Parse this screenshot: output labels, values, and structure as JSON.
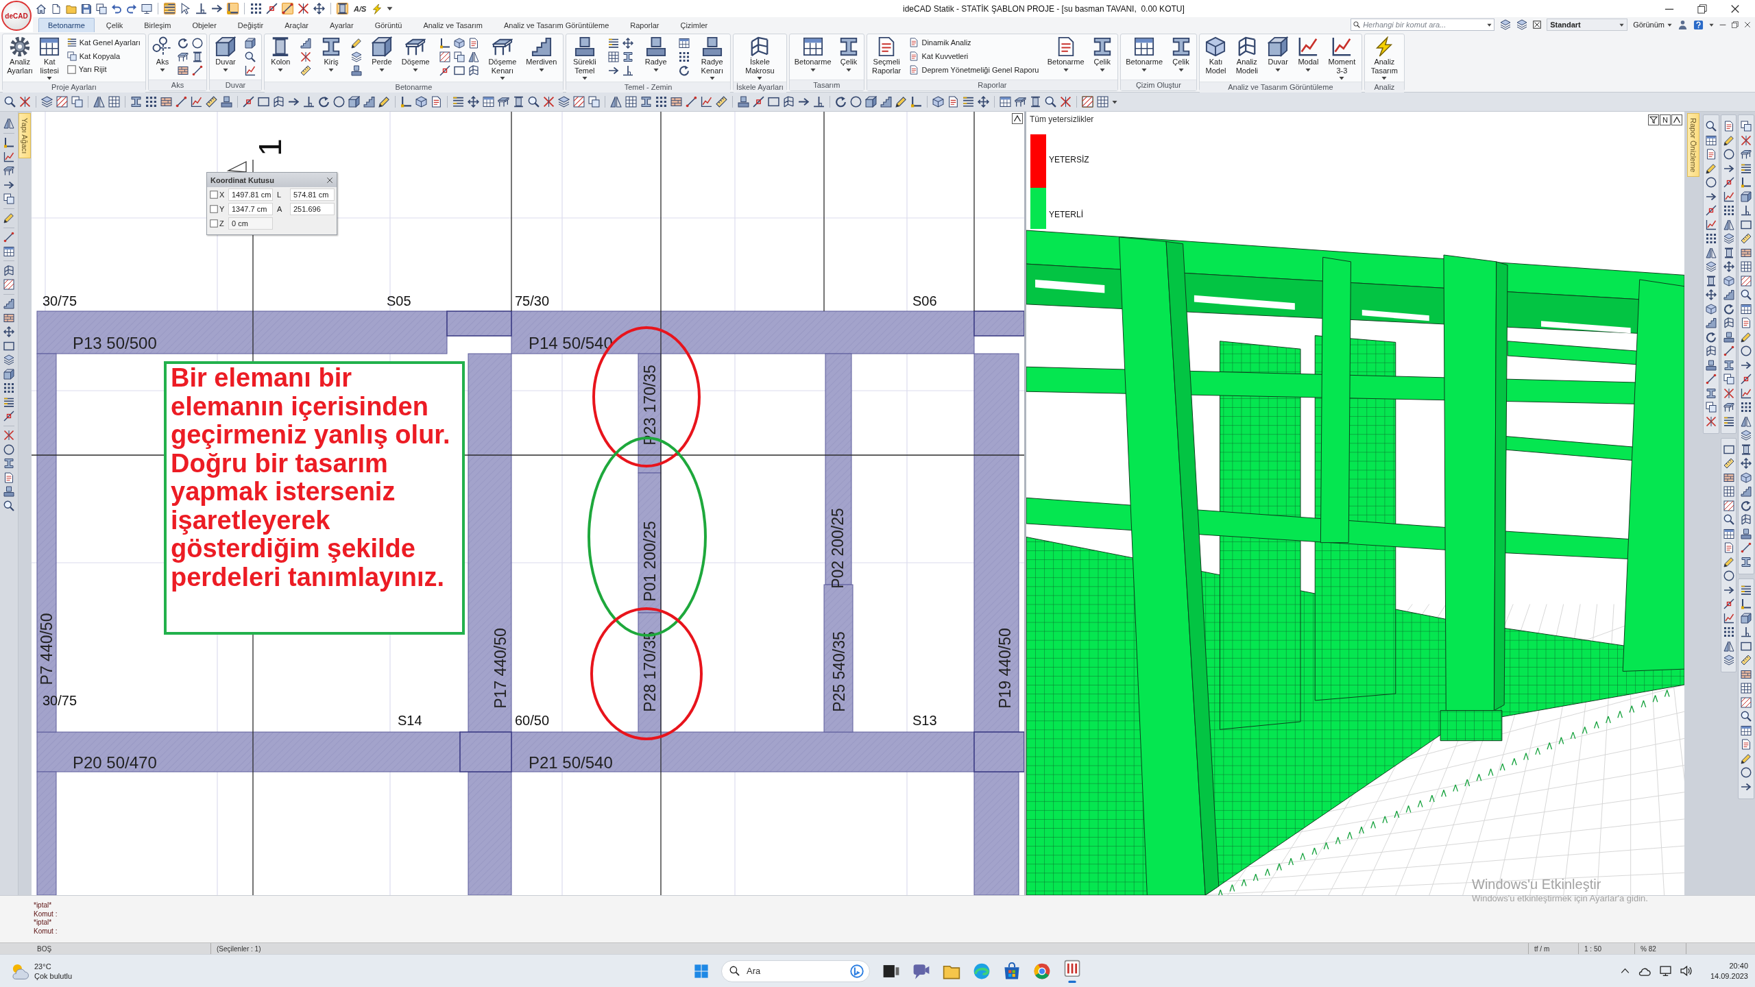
{
  "title_bar": {
    "logo": "deCAD",
    "snap_toggles": [
      {
        "on": true
      },
      {
        "on": false
      },
      {
        "on": false
      },
      {
        "on": false
      },
      {
        "on": true
      },
      {
        "on": false
      },
      {
        "on": false
      },
      {
        "on": true
      },
      {
        "on": false
      },
      {
        "on": false
      },
      {
        "on": true
      }
    ],
    "label_button": "A/S",
    "title": "ideCAD Statik - STATİK ŞABLON PROJE - [su basman TAVANI,  0.00 KOTU]"
  },
  "ribbon": {
    "tabs": [
      {
        "label": "Betonarme",
        "selected": true
      },
      {
        "label": "Çelik",
        "selected": false
      },
      {
        "label": "Birleşim",
        "selected": false
      },
      {
        "label": "Objeler",
        "selected": false
      },
      {
        "label": "Değiştir",
        "selected": false
      },
      {
        "label": "Araçlar",
        "selected": false
      },
      {
        "label": "Ayarlar",
        "selected": false
      },
      {
        "label": "Görüntü",
        "selected": false
      },
      {
        "label": "Analiz ve Tasarım",
        "selected": false
      },
      {
        "label": "Analiz ve Tasarım Görüntüleme",
        "selected": false
      },
      {
        "label": "Raporlar",
        "selected": false
      },
      {
        "label": "Çizimler",
        "selected": false
      }
    ],
    "search": {
      "placeholder": "Herhangi bir komut ara..."
    },
    "style_select": {
      "value": "Standart"
    },
    "view_menu": "Görünüm",
    "groups": [
      {
        "title": "Proje Ayarları",
        "items": [
          {
            "kind": "large",
            "label": "Analiz Ayarları",
            "menu": false
          },
          {
            "kind": "large",
            "label": "Kat listesi",
            "menu": true
          },
          {
            "kind": "stack",
            "rows": [
              {
                "kind": "small",
                "label": "Kat Genel Ayarları"
              },
              {
                "kind": "small",
                "label": "Kat Kopyala"
              },
              {
                "kind": "check",
                "label": "Yarı Rijit",
                "checked": false
              }
            ]
          }
        ]
      },
      {
        "title": "Aks",
        "items": [
          {
            "kind": "large",
            "label": "Aks",
            "menu": true
          },
          {
            "kind": "tools"
          }
        ]
      },
      {
        "title": "Duvar",
        "items": [
          {
            "kind": "large",
            "label": "Duvar",
            "menu": true
          },
          {
            "kind": "tools"
          }
        ]
      },
      {
        "title": "Betonarme",
        "items": [
          {
            "kind": "large",
            "label": "Kolon",
            "menu": true
          },
          {
            "kind": "tools"
          },
          {
            "kind": "large",
            "label": "Kiriş",
            "menu": true
          },
          {
            "kind": "tools"
          },
          {
            "kind": "large",
            "label": "Perde",
            "menu": true
          },
          {
            "kind": "large",
            "label": "Döşeme",
            "menu": true
          },
          {
            "kind": "tools"
          },
          {
            "kind": "large",
            "label": "Döşeme Kenarı",
            "menu": true
          },
          {
            "kind": "large",
            "label": "Merdiven",
            "menu": true
          }
        ]
      },
      {
        "title": "Temel - Zemin",
        "items": [
          {
            "kind": "large",
            "label": "Sürekli Temel",
            "menu": true
          },
          {
            "kind": "tools"
          },
          {
            "kind": "large",
            "label": "Radye",
            "menu": true
          },
          {
            "kind": "tools"
          },
          {
            "kind": "large",
            "label": "Radye Kenarı",
            "menu": true
          }
        ]
      },
      {
        "title": "İskele Ayarları",
        "items": [
          {
            "kind": "large",
            "label": "İskele Makrosu",
            "menu": true
          }
        ]
      },
      {
        "title": "Tasarım",
        "items": [
          {
            "kind": "large",
            "label": "Betonarme",
            "menu": true
          },
          {
            "kind": "large",
            "label": "Çelik",
            "menu": true
          }
        ]
      },
      {
        "title": "Raporlar",
        "items": [
          {
            "kind": "large",
            "label": "Seçmeli Raporlar",
            "menu": false
          },
          {
            "kind": "stack",
            "rows": [
              {
                "kind": "small",
                "label": "Dinamik Analiz"
              },
              {
                "kind": "small",
                "label": "Kat Kuvvetleri"
              },
              {
                "kind": "small",
                "label": "Deprem Yönetmeliği Genel Raporu"
              }
            ]
          },
          {
            "kind": "large",
            "label": "Betonarme",
            "menu": true
          },
          {
            "kind": "large",
            "label": "Çelik",
            "menu": true
          }
        ]
      },
      {
        "title": "Çizim Oluştur",
        "items": [
          {
            "kind": "large",
            "label": "Betonarme",
            "menu": true
          },
          {
            "kind": "large",
            "label": "Çelik",
            "menu": true
          }
        ]
      },
      {
        "title": "Analiz ve Tasarım Görüntüleme",
        "items": [
          {
            "kind": "large",
            "label": "Katı Model",
            "menu": false
          },
          {
            "kind": "large",
            "label": "Analiz Modeli",
            "menu": false
          },
          {
            "kind": "large",
            "label": "Duvar",
            "menu": true
          },
          {
            "kind": "large",
            "label": "Modal",
            "menu": true
          },
          {
            "kind": "large",
            "label": "Moment 3-3",
            "menu": true
          }
        ]
      },
      {
        "title": "Analiz",
        "items": [
          {
            "kind": "large",
            "label": "Analiz Tasarım",
            "menu": true
          }
        ]
      }
    ]
  },
  "toolbar": {
    "toggles": [
      {
        "on": true
      },
      {
        "on": false
      }
    ]
  },
  "side_tabs": {
    "left": "Yapı Ağacı",
    "right": "Rapor Önizleme"
  },
  "plan": {
    "axis_label": "1",
    "coordinate_box": {
      "title": "Koordinat Kutusu",
      "rows": [
        {
          "axis": "X",
          "checked": false,
          "value": "1497.81 cm",
          "extra_label": "L",
          "extra_value": "574.81 cm"
        },
        {
          "axis": "Y",
          "checked": false,
          "value": "1347.7 cm",
          "extra_label": "A",
          "extra_value": "251.696"
        },
        {
          "axis": "Z",
          "checked": false,
          "value": "0 cm"
        }
      ]
    },
    "labels": [
      {
        "kind": "section",
        "text": "30/75"
      },
      {
        "kind": "section",
        "text": "S05"
      },
      {
        "kind": "section",
        "text": "75/30"
      },
      {
        "kind": "section",
        "text": "S06"
      },
      {
        "kind": "wall",
        "text": "P13 50/500"
      },
      {
        "kind": "wall",
        "text": "P14 50/540"
      },
      {
        "kind": "wall_vertical",
        "text": "P23 170/35"
      },
      {
        "kind": "wall_vertical",
        "text": "P01 200/25"
      },
      {
        "kind": "wall_vertical",
        "text": "P02 200/25"
      },
      {
        "kind": "wall_vertical",
        "text": "P7 440/50"
      },
      {
        "kind": "section",
        "text": "30/75"
      },
      {
        "kind": "wall_vertical",
        "text": "P17 440/50"
      },
      {
        "kind": "wall_vertical",
        "text": "P28 170/35"
      },
      {
        "kind": "wall_vertical",
        "text": "P25 540/35"
      },
      {
        "kind": "wall_vertical",
        "text": "P19 440/50"
      },
      {
        "kind": "section",
        "text": "S14"
      },
      {
        "kind": "section",
        "text": "60/50"
      },
      {
        "kind": "section",
        "text": "S13"
      },
      {
        "kind": "wall",
        "text": "P20 50/470"
      },
      {
        "kind": "wall",
        "text": "P21 50/540"
      }
    ],
    "markers": [
      {
        "color": "#e8141c"
      },
      {
        "color": "#1ea83c"
      },
      {
        "color": "#e8141c"
      }
    ],
    "annotation": "Bir elemanı bir elemanın içerisinden geçirmeniz yanlış olur. Doğru bir tasarım yapmak isterseniz işaretleyerek gösterdiğim şekilde perdeleri tanımlayınız."
  },
  "view_3d": {
    "title": "Tüm yetersizlikler",
    "legend": [
      {
        "label": "YETERSİZ",
        "color": "#ff0000"
      },
      {
        "label": "YETERLİ",
        "color": "#05e650"
      }
    ],
    "letter_button": "N"
  },
  "command_lines": [
    "*iptal*",
    "Komut :",
    "*iptal*",
    "Komut :"
  ],
  "status_bar": {
    "mode": "BOŞ",
    "selection": "(Seçilenler : 1)",
    "units": "tf / m",
    "scale": "1 : 50",
    "zoom": "% 82"
  },
  "taskbar": {
    "weather": {
      "temperature": "23°C",
      "condition": "Çok bulutlu"
    },
    "search": {
      "placeholder": "Ara"
    },
    "apps": [
      {
        "active": false
      },
      {
        "active": false
      },
      {
        "active": false
      },
      {
        "active": false
      },
      {
        "active": false
      },
      {
        "active": false
      },
      {
        "active": true
      }
    ],
    "clock": {
      "time": "20:40",
      "date": "14.09.2023"
    }
  },
  "activation_notice": {
    "title": "Windows'u Etkinleştir",
    "text": "Windows'u etkinleştirmek için Ayarlar'a gidin."
  }
}
